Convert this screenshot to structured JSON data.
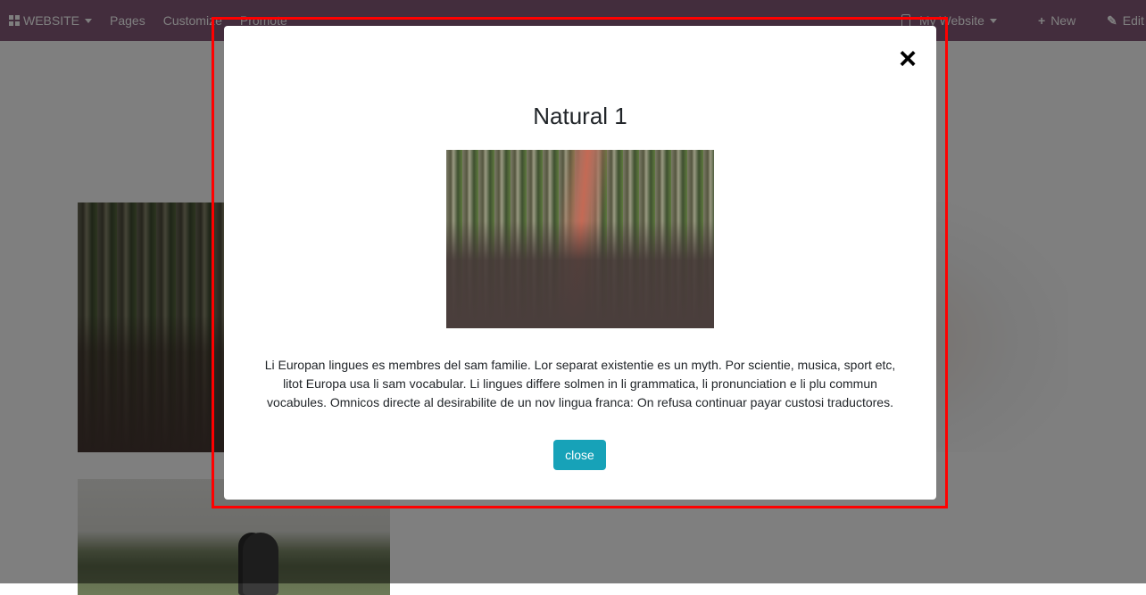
{
  "navbar": {
    "brand": "WEBSITE",
    "items": [
      {
        "label": "Pages"
      },
      {
        "label": "Customize"
      },
      {
        "label": "Promote"
      }
    ],
    "site_selector": "My Website",
    "new_label": "New",
    "edit_label": "Edit",
    "bg_color": "#875a7b"
  },
  "modal": {
    "title": "Natural 1",
    "image_alt": "Tree-lined road covered with leaves",
    "description": "Li Europan lingues es membres del sam familie. Lor separat existentie es un myth. Por scientie, musica, sport etc, litot Europa usa li sam vocabular. Li lingues differe solmen in li grammatica, li pronunciation e li plu commun vocabules. Omnicos directe al desirabilite de un nov lingua franca: On refusa continuar payar custosi traductores.",
    "close_button_label": "close",
    "close_icon": "×",
    "button_color": "#17a2b8",
    "highlight_color": "#ff0000"
  }
}
